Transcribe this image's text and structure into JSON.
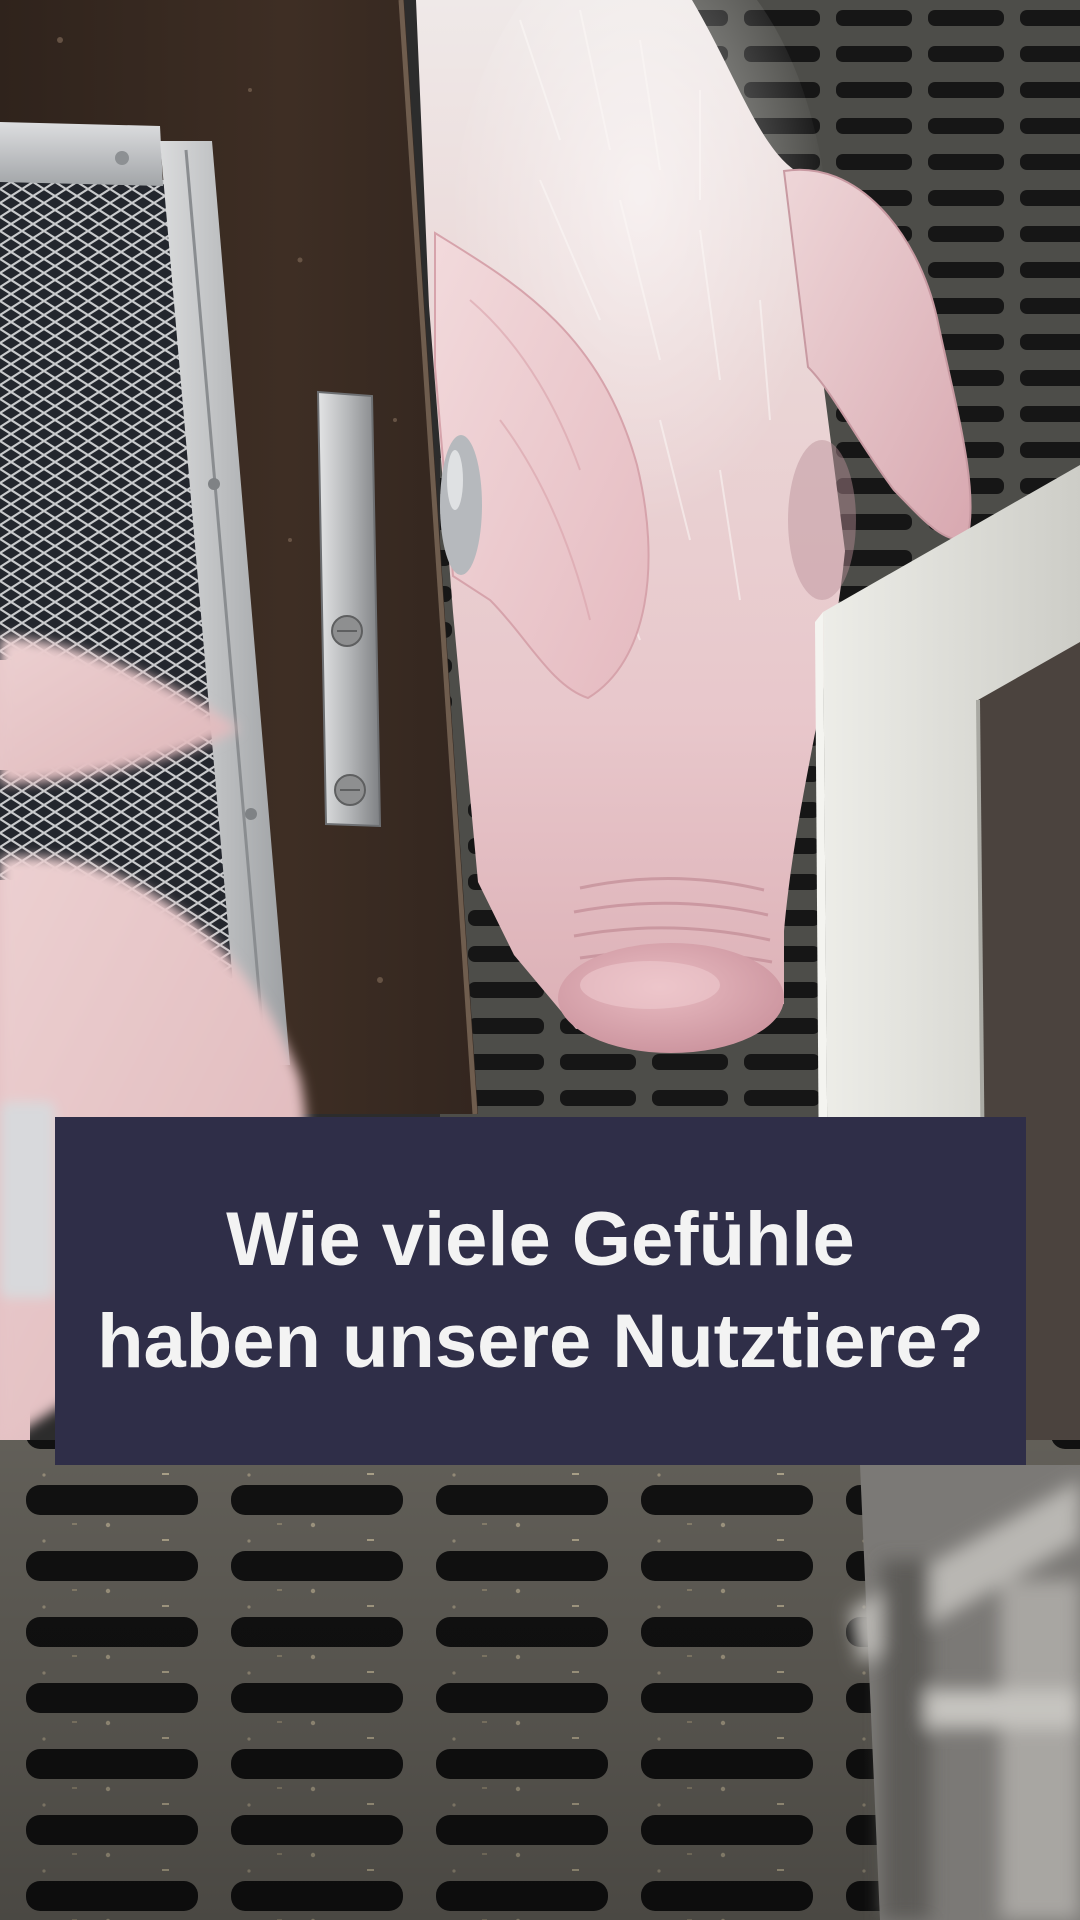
{
  "title": {
    "line1": "Wie viele Gefühle",
    "line2": "haben unsere Nutztiere?"
  },
  "colors": {
    "title_background": "#2f2e48",
    "title_text": "#f3f3f3"
  }
}
